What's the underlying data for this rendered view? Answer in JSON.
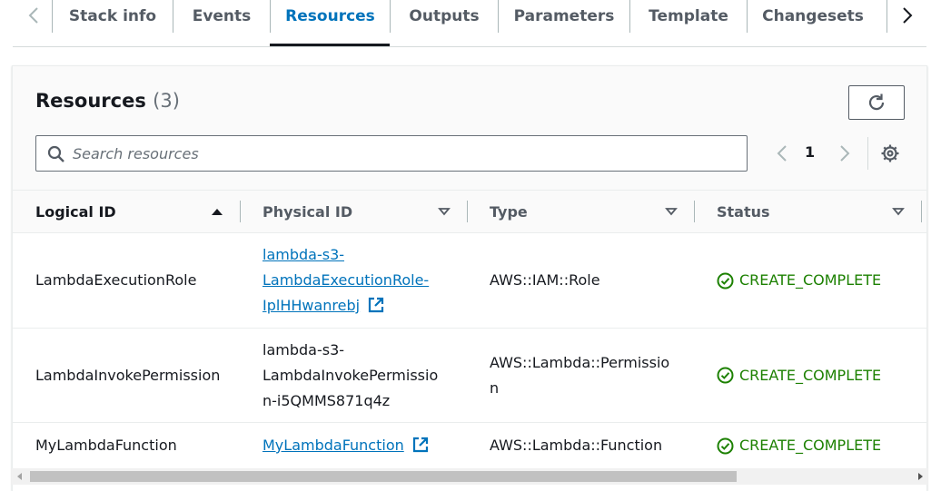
{
  "tabs": [
    {
      "label": "Stack info",
      "active": false
    },
    {
      "label": "Events",
      "active": false
    },
    {
      "label": "Resources",
      "active": true
    },
    {
      "label": "Outputs",
      "active": false
    },
    {
      "label": "Parameters",
      "active": false
    },
    {
      "label": "Template",
      "active": false
    },
    {
      "label": "Changesets",
      "active": false
    }
  ],
  "panel": {
    "title": "Resources",
    "count": "(3)",
    "search_placeholder": "Search resources",
    "search_value": "",
    "page": "1"
  },
  "table": {
    "columns": [
      "Logical ID",
      "Physical ID",
      "Type",
      "Status"
    ],
    "sorted_column": "Logical ID",
    "sort_direction": "ascending",
    "rows": [
      {
        "logical_id": "LambdaExecutionRole",
        "physical_id_lines": [
          "lambda-s3-",
          "LambdaExecutionRole-",
          "IplHHwanrebj"
        ],
        "physical_id_link": true,
        "type": "AWS::IAM::Role",
        "status": "CREATE_COMPLETE"
      },
      {
        "logical_id": "LambdaInvokePermission",
        "physical_id_lines": [
          "lambda-s3-",
          "LambdaInvokePermissio",
          "n-i5QMMS871q4z"
        ],
        "physical_id_link": false,
        "type": "AWS::Lambda::Permission",
        "status": "CREATE_COMPLETE"
      },
      {
        "logical_id": "MyLambdaFunction",
        "physical_id_lines": [
          "MyLambdaFunction"
        ],
        "physical_id_link": true,
        "type": "AWS::Lambda::Function",
        "status": "CREATE_COMPLETE"
      }
    ]
  },
  "icons": {
    "tabs_prev": "chevron-left-icon",
    "tabs_next": "chevron-right-icon",
    "refresh": "refresh-icon",
    "search": "search-icon",
    "page_prev": "chevron-left-icon",
    "page_next": "chevron-right-icon",
    "settings": "gear-icon",
    "sort_asc": "caret-up-icon",
    "sort_none": "caret-down-outline-icon",
    "external_link": "external-link-icon",
    "status_ok": "check-circle-icon"
  },
  "colors": {
    "link": "#0073bb",
    "success": "#1d8102",
    "active_tab": "#0073bb",
    "text": "#16191f",
    "muted": "#545b64"
  }
}
